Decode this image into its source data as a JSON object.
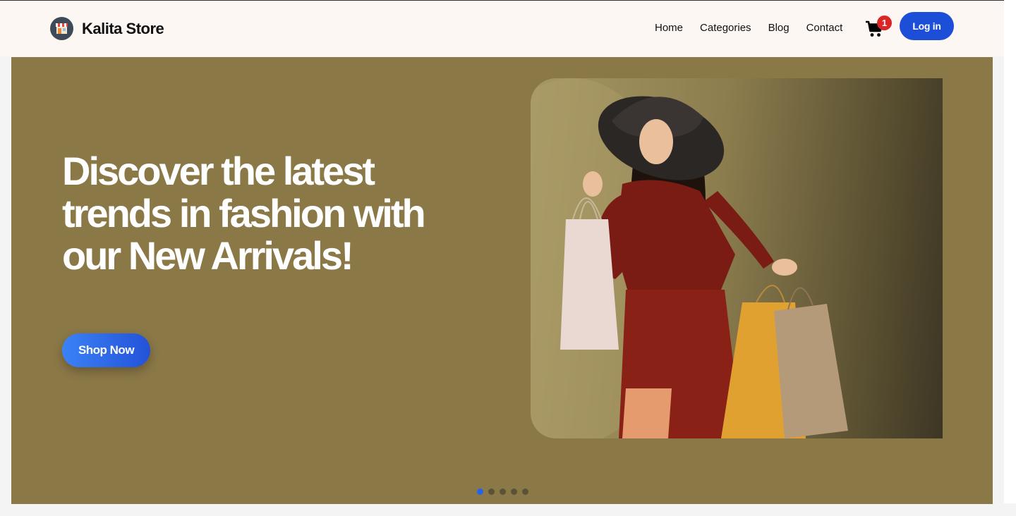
{
  "brand": {
    "name": "Kalita Store",
    "logo_icon": "storefront-icon"
  },
  "nav": {
    "links": [
      "Home",
      "Categories",
      "Blog",
      "Contact"
    ],
    "cart_icon": "cart-icon",
    "cart_count": "1",
    "login_label": "Log in"
  },
  "hero": {
    "title": "Discover the latest trends in fashion with our New Arrivals!",
    "cta_label": "Shop Now",
    "image_subject": "woman-with-shopping-bags",
    "slides_total": 5,
    "active_slide": 1
  },
  "colors": {
    "navbar_bg": "#fdf7f3",
    "hero_bg": "#8b7847",
    "primary": "#1d4ed8",
    "badge": "#dc2626",
    "dot_active": "#2563eb"
  }
}
